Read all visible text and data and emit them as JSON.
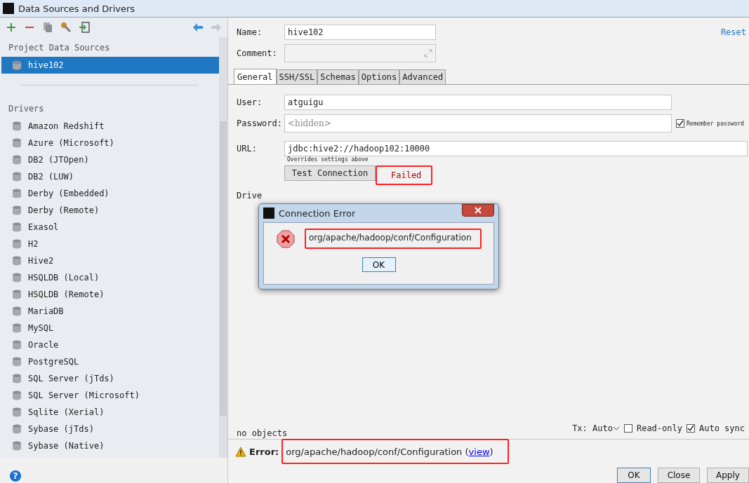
{
  "window": {
    "title": "Data Sources and Drivers"
  },
  "project_sources": {
    "title": "Project Data Sources",
    "items": [
      {
        "label": "hive102",
        "selected": true
      }
    ]
  },
  "drivers": {
    "title": "Drivers",
    "items": [
      {
        "label": "Amazon Redshift"
      },
      {
        "label": "Azure (Microsoft)"
      },
      {
        "label": "DB2 (JTOpen)"
      },
      {
        "label": "DB2 (LUW)"
      },
      {
        "label": "Derby (Embedded)"
      },
      {
        "label": "Derby (Remote)"
      },
      {
        "label": "Exasol"
      },
      {
        "label": "H2"
      },
      {
        "label": "Hive2"
      },
      {
        "label": "HSQLDB (Local)"
      },
      {
        "label": "HSQLDB (Remote)"
      },
      {
        "label": "MariaDB"
      },
      {
        "label": "MySQL"
      },
      {
        "label": "Oracle"
      },
      {
        "label": "PostgreSQL"
      },
      {
        "label": "SQL Server (jTds)"
      },
      {
        "label": "SQL Server (Microsoft)"
      },
      {
        "label": "Sqlite (Xerial)"
      },
      {
        "label": "Sybase (jTds)"
      },
      {
        "label": "Sybase (Native)"
      }
    ]
  },
  "form": {
    "name_label": "Name:",
    "name_value": "hive102",
    "comment_label": "Comment:",
    "reset": "Reset",
    "tabs": [
      {
        "label": "General",
        "selected": true
      },
      {
        "label": "SSH/SSL",
        "selected": false
      },
      {
        "label": "Schemas",
        "selected": false
      },
      {
        "label": "Options",
        "selected": false
      },
      {
        "label": "Advanced",
        "selected": false
      }
    ],
    "user_label": "User:",
    "user_value": "atguigu",
    "password_label": "Password:",
    "password_placeholder": "<hidden>",
    "remember": {
      "label": "Remember password",
      "checked": true
    },
    "url_label": "URL:",
    "url_value": "jdbc:hive2://hadoop102:10000",
    "url_hint": "Overrides settings above",
    "test_button": "Test Connection",
    "test_status": "Failed",
    "driver_label": "Drive"
  },
  "dialog": {
    "title": "Connection Error",
    "message": "org/apache/hadoop/conf/Configuration",
    "ok": "OK"
  },
  "status": {
    "text": "no objects",
    "tx": "Tx: Auto",
    "read_only": {
      "label": "Read-only",
      "checked": false
    },
    "auto_sync": {
      "label": "Auto sync",
      "checked": true
    }
  },
  "error_bar": {
    "label": "Error:",
    "message": "org/apache/hadoop/conf/Configuration",
    "open": "(",
    "link": "view",
    "close": ")"
  },
  "buttons": [
    "OK",
    "Close",
    "Apply"
  ],
  "help": "?"
}
